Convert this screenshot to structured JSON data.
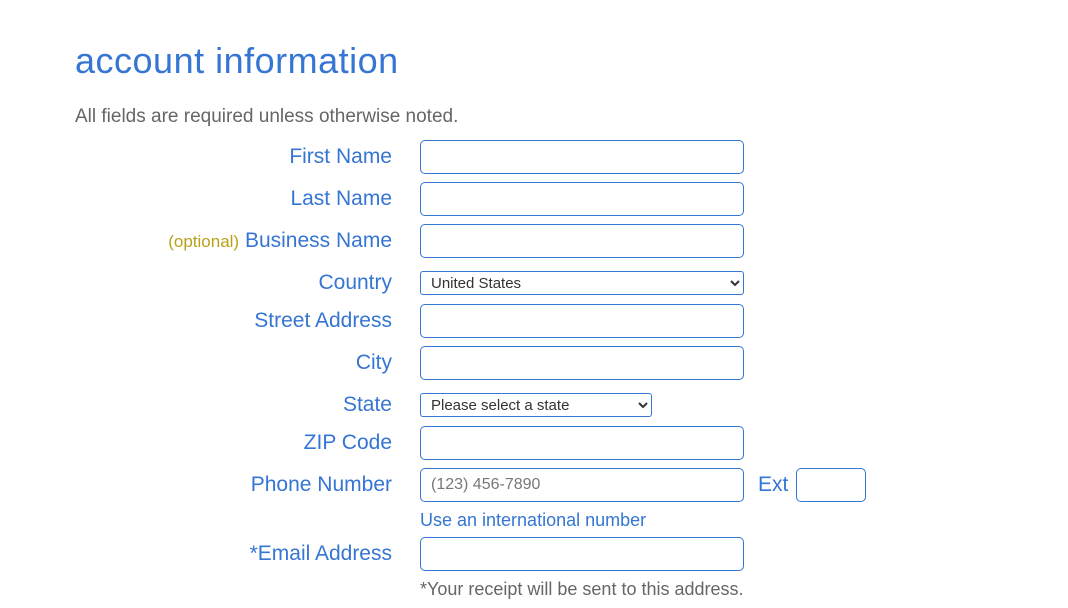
{
  "page": {
    "title": "account information",
    "subtitle": "All fields are required unless otherwise noted."
  },
  "labels": {
    "first_name": "First Name",
    "last_name": "Last Name",
    "business_name": "Business Name",
    "optional_prefix": "(optional)",
    "country": "Country",
    "street_address": "Street Address",
    "city": "City",
    "state": "State",
    "zip": "ZIP Code",
    "phone": "Phone Number",
    "ext": "Ext",
    "email": "Email Address",
    "email_asterisk": "*"
  },
  "fields": {
    "first_name": "",
    "last_name": "",
    "business_name": "",
    "country_selected": "United States",
    "street_address": "",
    "city": "",
    "state_selected": "Please select a state",
    "zip": "",
    "phone_placeholder": "(123) 456-7890",
    "phone": "",
    "ext": "",
    "email": ""
  },
  "helpers": {
    "intl_link": "Use an international number",
    "email_note": "*Your receipt will be sent to this address."
  }
}
